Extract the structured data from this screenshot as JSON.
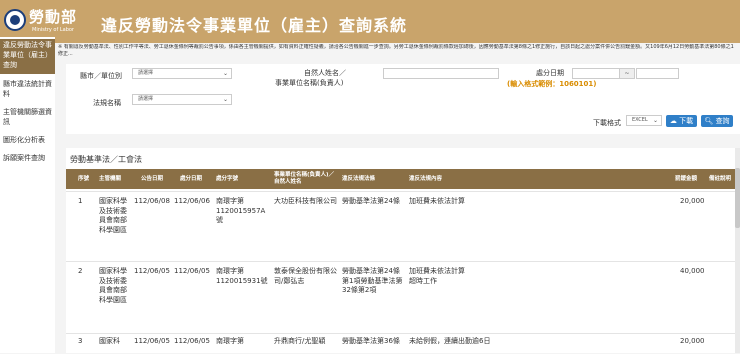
{
  "header": {
    "ministry": "勞動部",
    "ministry_en": "Ministry of Labor",
    "title": "違反勞動法令事業單位（雇主）查詢系統"
  },
  "notice": "※ 有關違反勞動基準法、性別工作平等法、勞工退休金條例等裁罰公告事項，係由各主管機關提供，如有資料正確性疑義，請洽各公告機關進一步查詢。另勞工退休金條例裁罰條款經加總後，因應勞動基準法第8條之1修正施行，自該日起之處分案件併公告罰鍰金額。又109年6月12日勞動基準法第80條之1修正...",
  "sidebar": {
    "items": [
      {
        "label": "違反勞動法令事業單位（雇主）查詢"
      },
      {
        "label": "縣市違法統計資料"
      },
      {
        "label": "主管機關篩選資訊"
      },
      {
        "label": "圖形化分析表"
      },
      {
        "label": "訴願案件查詢"
      }
    ]
  },
  "search": {
    "county_label": "縣市／單位別",
    "county_value": "請選擇",
    "name_label_1": "自然人姓名／",
    "name_label_2": "事業單位名稱(負責人)",
    "date_label": "處分日期",
    "date_sep": "~",
    "hint": "(輸入格式範例：1060101)",
    "law_label": "法規名稱",
    "law_value": "請選擇",
    "format_label": "下載格式",
    "format_value": "EXCEL",
    "download_label": "下載",
    "query_label": "查詢"
  },
  "results": {
    "section_title": "勞動基準法／工會法",
    "columns": [
      "序號",
      "主管機關",
      "公告日期",
      "處分日期",
      "處分字號",
      "事業單位名稱(負責人)／自然人姓名",
      "違反法規法條",
      "違反法規內容",
      "罰鍰金額",
      "備註說明"
    ],
    "rows": [
      {
        "no": "1",
        "agency": "國家科學及技術委員會南部科學園區",
        "announce_date": "112/06/08",
        "penalty_date": "112/06/06",
        "doc_no": "南環字第1120015957A號",
        "company": "大功臣科技有限公司",
        "law": "勞動基準法第24條",
        "content": "加班費未依法計算",
        "amount": "20,000",
        "note": ""
      },
      {
        "no": "2",
        "agency": "國家科學及技術委員會南部科學園區",
        "announce_date": "112/06/05",
        "penalty_date": "112/06/05",
        "doc_no": "南環字第1120015931號",
        "company": "敦泰保全股份有限公司/鄭弘志",
        "law": "勞動基準法第24條第1項勞動基準法第32條第2項",
        "content": "加班費未依法計算超時工作",
        "amount": "40,000",
        "note": ""
      },
      {
        "no": "3",
        "agency": "國家科",
        "announce_date": "112/06/05",
        "penalty_date": "112/06/05",
        "doc_no": "南環字第",
        "company": "升鼎商行/尤聖穎",
        "law": "勞動基準法第36條",
        "content": "未給例假，連續出勤逾6日",
        "amount": "20,000",
        "note": ""
      }
    ]
  },
  "colors": {
    "header_bg": "#c9a46b",
    "table_header_bg": "#8a6f45",
    "button_blue": "#2f7fc8",
    "hint_orange": "#d98c00"
  }
}
